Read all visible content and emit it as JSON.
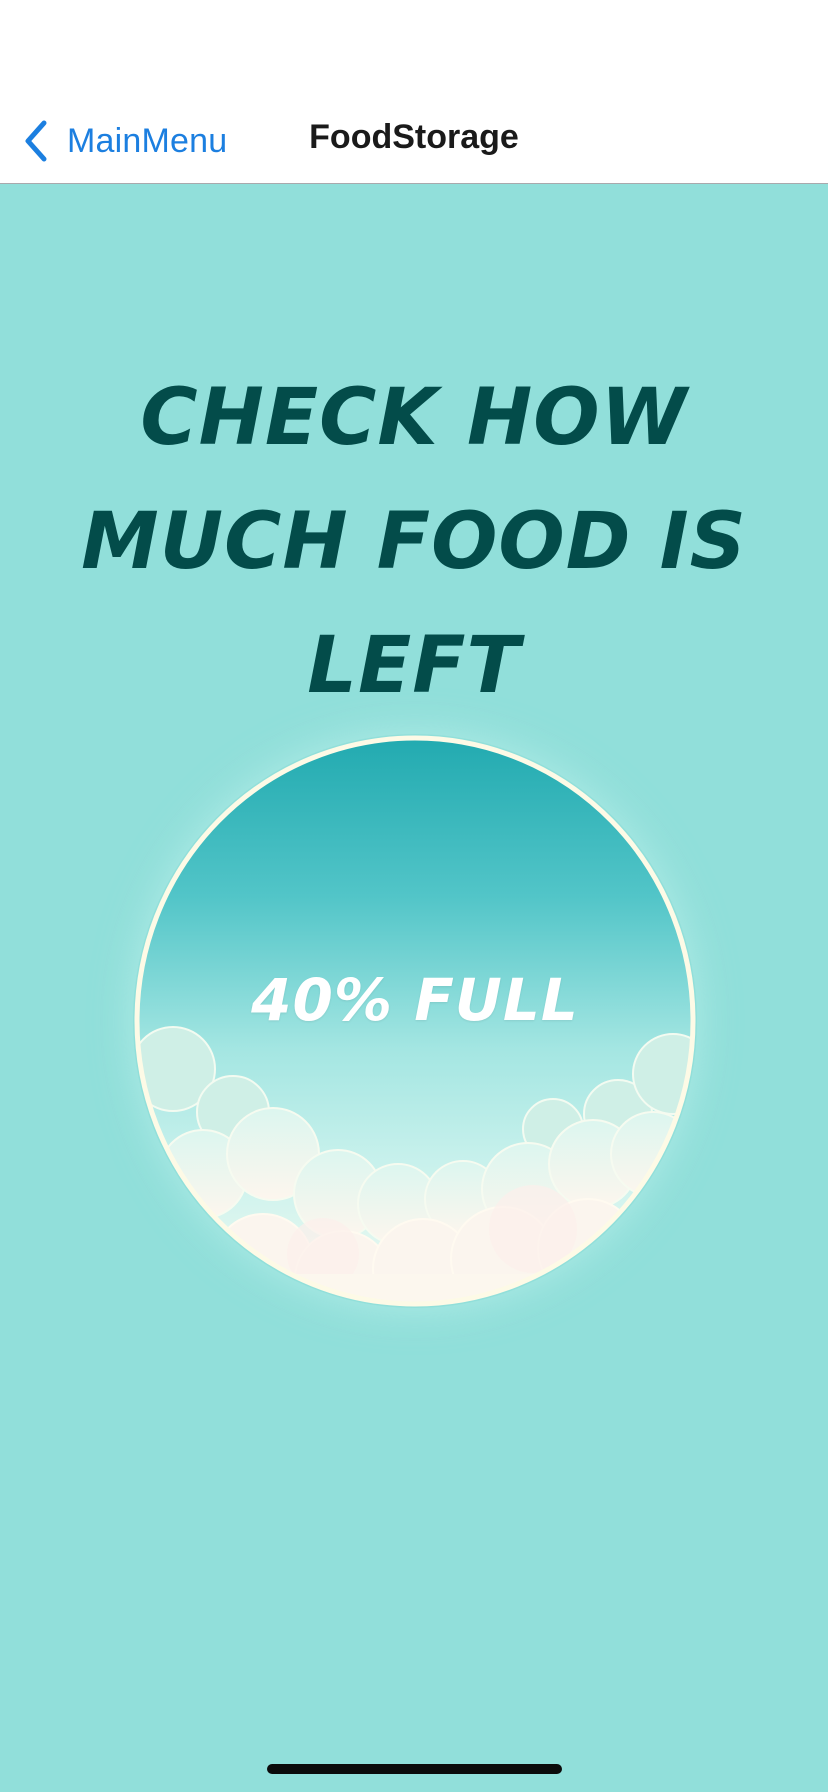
{
  "nav": {
    "back_label": "MainMenu",
    "title": "FoodStorage",
    "back_icon": "chevron-left-icon"
  },
  "main": {
    "headline": "CHECK HOW MUCH FOOD IS LEFT",
    "gauge": {
      "label": "40% FULL",
      "fill_percent": 40
    }
  },
  "colors": {
    "accent": "#1c7fe0",
    "background": "#91dfda",
    "headline": "#034c4a",
    "gauge_top": "#22aab0",
    "gauge_rim": "#fdfae6"
  }
}
